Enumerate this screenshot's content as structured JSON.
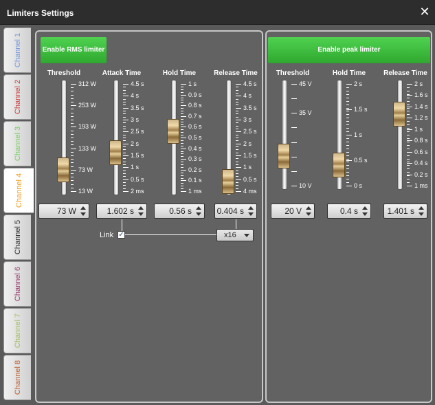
{
  "window": {
    "title": "Limiters Settings",
    "close_icon": "close-icon"
  },
  "tabs": [
    {
      "label": "Channel 1",
      "color": "#7a9be0"
    },
    {
      "label": "Channel 2",
      "color": "#d04040"
    },
    {
      "label": "Channel 3",
      "color": "#7ad060"
    },
    {
      "label": "Channel 4",
      "color": "#f0a020"
    },
    {
      "label": "Channel 5",
      "color": "#333333"
    },
    {
      "label": "Channel 6",
      "color": "#a04070"
    },
    {
      "label": "Channel 7",
      "color": "#a0c060"
    },
    {
      "label": "Channel 8",
      "color": "#c06030"
    }
  ],
  "active_tab_index": 3,
  "rms": {
    "enable_label": "Enable RMS limiter",
    "threshold": {
      "label": "Threshold",
      "ticks": [
        "312 W",
        "253 W",
        "193 W",
        "133 W",
        "73 W",
        "13 W"
      ],
      "value": "73 W",
      "level": 0.2
    },
    "attack": {
      "label": "Attack Time",
      "ticks": [
        "4.5 s",
        "4 s",
        "3.5 s",
        "3 s",
        "2.5 s",
        "2 s",
        "1.5 s",
        "1 s",
        "0.5 s",
        "2 ms"
      ],
      "value": "1.602 s",
      "level": 0.36
    },
    "hold": {
      "label": "Hold Time",
      "ticks": [
        "1 s",
        "0.9 s",
        "0.8 s",
        "0.7 s",
        "0.6 s",
        "0.5 s",
        "0.4 s",
        "0.3 s",
        "0.2 s",
        "0.1 s",
        "1 ms"
      ],
      "value": "0.56 s",
      "level": 0.56
    },
    "release": {
      "label": "Release Time",
      "ticks": [
        "4.5 s",
        "4 s",
        "3.5 s",
        "3 s",
        "2.5 s",
        "2 s",
        "1.5 s",
        "1 s",
        "0.5 s",
        "4 ms"
      ],
      "value": "0.404 s",
      "level": 0.09
    },
    "link_label": "Link",
    "link_checked": "✓",
    "multiplier": "x16"
  },
  "peak": {
    "enable_label": "Enable peak limiter",
    "threshold": {
      "label": "Threshold",
      "ticks": [
        "45 V",
        "",
        "35 V",
        "",
        "",
        "",
        "",
        "10 V"
      ],
      "value": "20 V",
      "level": 0.29
    },
    "hold": {
      "label": "Hold Time",
      "ticks": [
        "2 s",
        "1.5 s",
        "1 s",
        "0.5 s",
        "0 s"
      ],
      "value": "0.4 s",
      "level": 0.2
    },
    "release": {
      "label": "Release Time",
      "ticks": [
        "2 s",
        "1.6 s",
        "1.4 s",
        "1.2 s",
        "1 s",
        "0.8 s",
        "0.6 s",
        "0.4 s",
        "0.2 s",
        "1 ms"
      ],
      "value": "1.401 s",
      "level": 0.7
    }
  }
}
